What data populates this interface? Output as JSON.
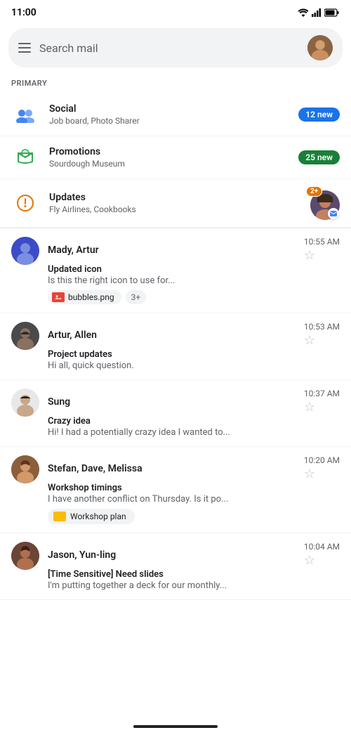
{
  "statusBar": {
    "time": "11:00"
  },
  "searchBar": {
    "placeholder": "Search mail"
  },
  "sectionLabel": "PRIMARY",
  "categories": [
    {
      "id": "social",
      "name": "Social",
      "sub": "Job board, Photo Sharer",
      "badge": "12 new",
      "badgeType": "blue"
    },
    {
      "id": "promotions",
      "name": "Promotions",
      "sub": "Sourdough Museum",
      "badge": "25 new",
      "badgeType": "green"
    },
    {
      "id": "updates",
      "name": "Updates",
      "sub": "Fly Airlines, Cookbooks",
      "badge": "2+",
      "badgeType": "avatar"
    }
  ],
  "emails": [
    {
      "id": "email1",
      "sender": "Mady, Artur",
      "time": "10:55 AM",
      "subject": "Updated icon",
      "preview": "Is this the right icon to use for...",
      "avatarColor": "#3c4bc8",
      "avatarType": "image",
      "attachments": [
        "bubbles.png"
      ],
      "attachMore": "3+"
    },
    {
      "id": "email2",
      "sender": "Artur, Allen",
      "time": "10:53 AM",
      "subject": "Project updates",
      "preview": "Hi all, quick question.",
      "avatarColor": "#4a4a4a",
      "avatarType": "image"
    },
    {
      "id": "email3",
      "sender": "Sung",
      "time": "10:37 AM",
      "subject": "Crazy idea",
      "preview": "Hi! I had a potentially crazy idea I wanted to...",
      "avatarColor": "#e8e8e8",
      "avatarType": "image"
    },
    {
      "id": "email4",
      "sender": "Stefan, Dave, Melissa",
      "time": "10:20 AM",
      "subject": "Workshop timings",
      "preview": "I have another conflict on Thursday. Is it po...",
      "avatarColor": "#8b4513",
      "avatarType": "image",
      "workshopAttach": "Workshop plan"
    },
    {
      "id": "email5",
      "sender": "Jason, Yun-ling",
      "time": "10:04 AM",
      "subject": "[Time Sensitive] Need slides",
      "preview": "I'm putting together a deck for our monthly...",
      "avatarColor": "#5c3d2e",
      "avatarType": "image"
    }
  ]
}
